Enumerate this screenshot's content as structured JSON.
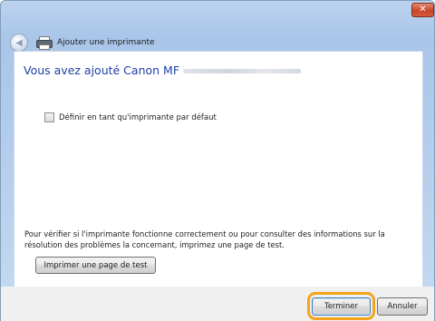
{
  "window": {
    "title": "Ajouter une imprimante",
    "close_label": "✕"
  },
  "main": {
    "heading": "Vous avez ajouté Canon MF",
    "checkbox_label": "Définir en tant qu'imprimante par défaut",
    "checkbox_checked": false,
    "info_text": "Pour vérifier si l'imprimante fonctionne correctement ou pour consulter des informations sur la résolution des problèmes la concernant, imprimez une page de test.",
    "test_page_button": "Imprimer une page de test"
  },
  "footer": {
    "finish_button": "Terminer",
    "cancel_button": "Annuler"
  },
  "colors": {
    "heading": "#1d3fa8",
    "highlight": "#f5a31a",
    "close_button": "#c9452a"
  },
  "icons": [
    "back-arrow-icon",
    "printer-icon",
    "close-icon"
  ]
}
